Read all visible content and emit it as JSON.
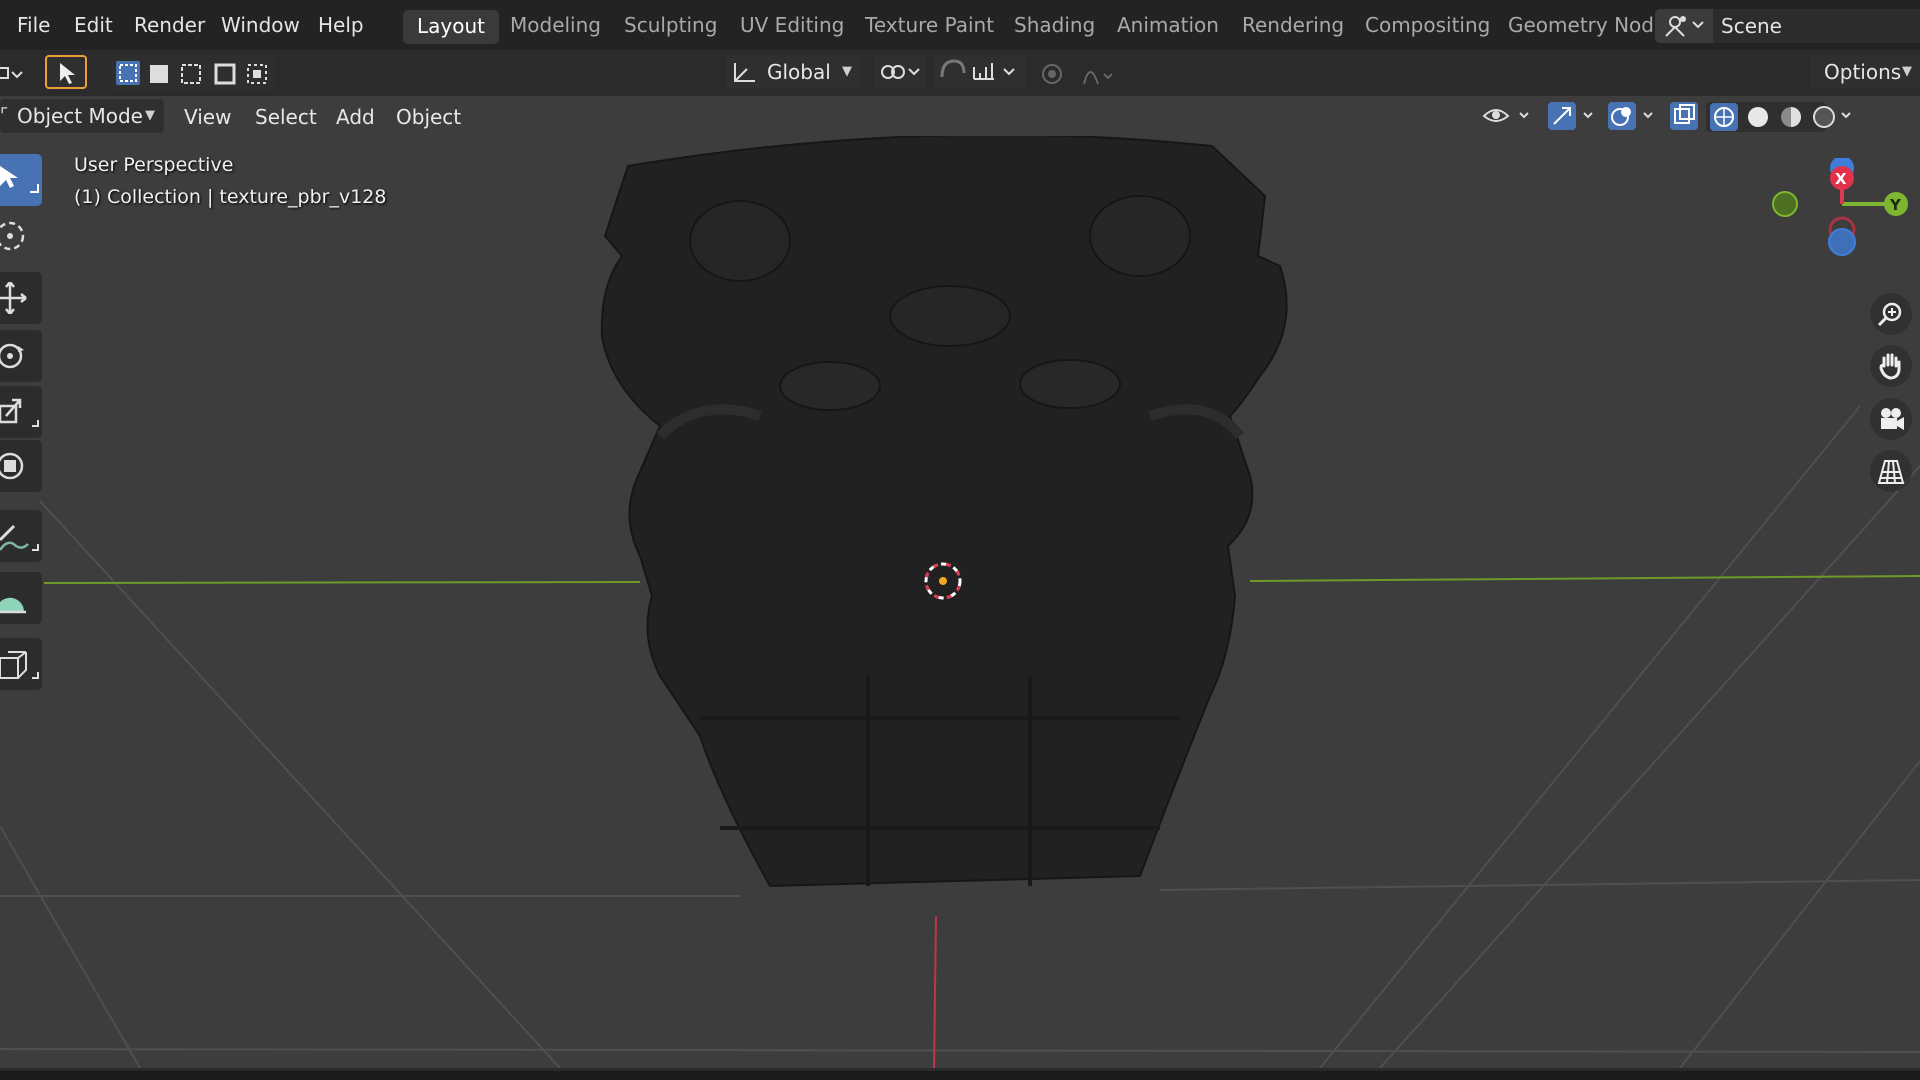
{
  "menu": {
    "file": "File",
    "edit": "Edit",
    "render": "Render",
    "window": "Window",
    "help": "Help"
  },
  "workspaces": [
    {
      "label": "Layout",
      "active": true
    },
    {
      "label": "Modeling"
    },
    {
      "label": "Sculpting"
    },
    {
      "label": "UV Editing"
    },
    {
      "label": "Texture Paint"
    },
    {
      "label": "Shading"
    },
    {
      "label": "Animation"
    },
    {
      "label": "Rendering"
    },
    {
      "label": "Compositing"
    },
    {
      "label": "Geometry Nod"
    }
  ],
  "scene": {
    "label": "Scene"
  },
  "tool_header": {
    "orientation": "Global",
    "options_label": "Options"
  },
  "viewport_header": {
    "mode": "Object Mode",
    "view": "View",
    "select": "Select",
    "add": "Add",
    "object": "Object"
  },
  "viewport": {
    "perspective": "User Perspective",
    "collection": "(1) Collection | texture_pbr_v128"
  },
  "gizmo": {
    "x": "X",
    "y": "Y"
  },
  "colors": {
    "accent": "#4772b3",
    "x_axis": "#d93b52",
    "y_axis": "#7fb631",
    "z_axis": "#3f7ed8",
    "grid_line": "#565656",
    "viewport_bg": "#3d3d3d"
  },
  "icons": [
    "select-cursor-icon",
    "cursor-icon",
    "move-icon",
    "rotate-icon",
    "scale-icon",
    "transform-icon",
    "annotate-icon",
    "measure-icon",
    "add-cube-icon",
    "zoom-icon",
    "hand-icon",
    "camera-icon",
    "grid-icon"
  ]
}
